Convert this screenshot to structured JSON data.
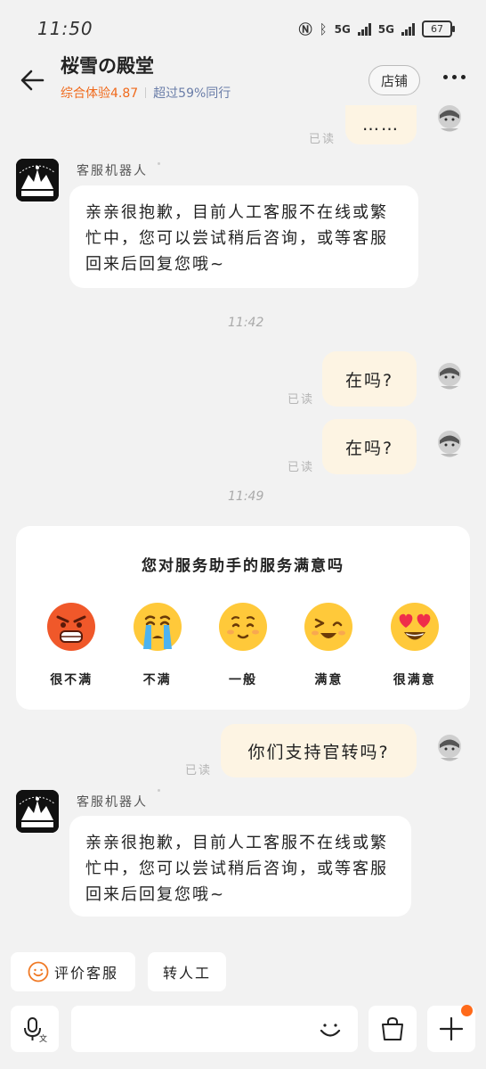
{
  "status_bar": {
    "time": "11:50",
    "network": "5G",
    "battery": "67"
  },
  "header": {
    "shop_name": "桜雪の殿堂",
    "score": "综合体验4.87",
    "beyond": "超过59%同行",
    "store_label": "店铺"
  },
  "messages": {
    "top_partial": "……",
    "read_label": "已读",
    "bot_name": "客服机器人",
    "bot_reply": "亲亲很抱歉，目前人工客服不在线或繁忙中，您可以尝试稍后咨询，或等客服回来后回复您哦~",
    "time_1": "11:42",
    "user_q1": "在吗?",
    "user_q2": "在吗?",
    "time_2": "11:49",
    "user_q3": "你们支持官转吗?",
    "bot_reply_2": "亲亲很抱歉，目前人工客服不在线或繁忙中，您可以尝试稍后咨询，或等客服回来后回复您哦~"
  },
  "survey": {
    "title": "您对服务助手的服务满意吗",
    "options": [
      {
        "label": "很不满",
        "icon": "angry-face-icon"
      },
      {
        "label": "不满",
        "icon": "crying-face-icon"
      },
      {
        "label": "一般",
        "icon": "neutral-face-icon"
      },
      {
        "label": "满意",
        "icon": "happy-face-icon"
      },
      {
        "label": "很满意",
        "icon": "heart-eyes-face-icon"
      }
    ]
  },
  "quick_actions": {
    "rate": "评价客服",
    "transfer": "转人工"
  },
  "input_bar": {
    "voice_icon": "mic-icon",
    "emoji_icon": "smile-icon",
    "bag_icon": "shopping-bag-icon",
    "plus_icon": "plus-icon"
  },
  "colors": {
    "accent": "#f06a1c",
    "bubble": "#fdf4e3",
    "background": "#f2f2f2"
  }
}
